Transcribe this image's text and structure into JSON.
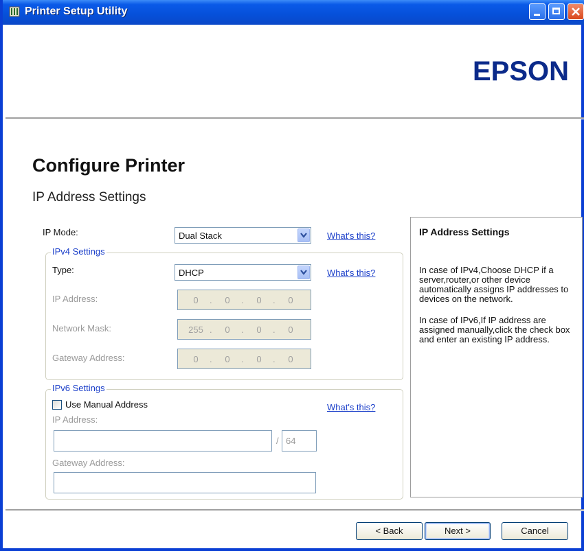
{
  "window": {
    "title": "Printer Setup Utility",
    "icons": {
      "app": "printer-app-icon",
      "minimize": "minimize-icon",
      "maximize": "maximize-icon",
      "close": "close-icon"
    }
  },
  "brand": {
    "logo": "EPSON",
    "color": "#0b2a8a"
  },
  "page": {
    "title": "Configure Printer",
    "subtitle": "IP Address Settings"
  },
  "ip_mode": {
    "label": "IP Mode:",
    "value": "Dual Stack",
    "help": "What's this?"
  },
  "ipv4": {
    "legend": "IPv4 Settings",
    "type_label": "Type:",
    "type_value": "DHCP",
    "help": "What's this?",
    "ip_label": "IP Address:",
    "ip": [
      "0",
      "0",
      "0",
      "0"
    ],
    "mask_label": "Network Mask:",
    "mask": [
      "255",
      "0",
      "0",
      "0"
    ],
    "gateway_label": "Gateway Address:",
    "gateway": [
      "0",
      "0",
      "0",
      "0"
    ]
  },
  "ipv6": {
    "legend": "IPv6 Settings",
    "manual_label": "Use Manual Address",
    "manual_checked": false,
    "help": "What's this?",
    "ip_label": "IP Address:",
    "ip_value": "",
    "slash": "/",
    "prefix": "64",
    "gateway_label": "Gateway Address:",
    "gateway_value": ""
  },
  "info": {
    "title": "IP Address Settings",
    "para1": "In case of IPv4,Choose DHCP if a server,router,or other device automatically assigns IP addresses to devices on the network.",
    "para2": "In case of IPv6,If IP address are assigned manually,click the check box and enter an existing IP address."
  },
  "footer": {
    "back": "< Back",
    "next": "Next >",
    "cancel": "Cancel"
  }
}
